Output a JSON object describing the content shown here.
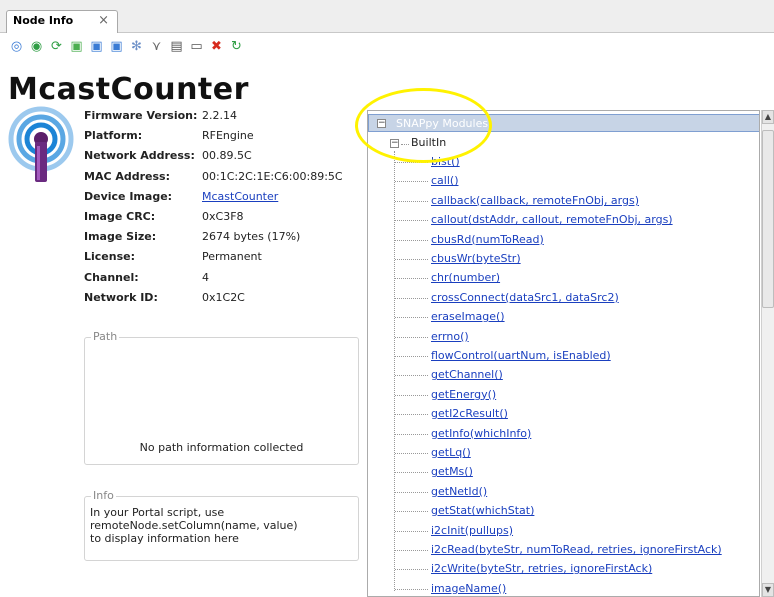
{
  "tab": {
    "label": "Node Info",
    "close_glyph": "×"
  },
  "toolbar": {
    "buttons": [
      {
        "icon": "ping-icon",
        "glyph": "◎",
        "color": "#3a7bd5"
      },
      {
        "icon": "refresh-icon",
        "glyph": "◉",
        "color": "#2f9e44"
      },
      {
        "icon": "sync-icon",
        "glyph": "⟳",
        "color": "#2f9e44"
      },
      {
        "icon": "upload-script-icon",
        "glyph": "▣",
        "color": "#4caf50"
      },
      {
        "icon": "script-icon",
        "glyph": "▣",
        "color": "#3a7bd5"
      },
      {
        "icon": "script-edit-icon",
        "glyph": "▣",
        "color": "#3a7bd5"
      },
      {
        "icon": "gear-icon",
        "glyph": "✻",
        "color": "#6b8fc7"
      },
      {
        "icon": "network-icon",
        "glyph": "⋎",
        "color": "#666666"
      },
      {
        "icon": "copy-icon",
        "glyph": "▤",
        "color": "#555555"
      },
      {
        "icon": "minimize-icon",
        "glyph": "▭",
        "color": "#555555"
      },
      {
        "icon": "delete-icon",
        "glyph": "✖",
        "color": "#d62b1e"
      },
      {
        "icon": "reload-icon",
        "glyph": "↻",
        "color": "#2f9e44"
      }
    ]
  },
  "node": {
    "name": "McastCounter",
    "fields": [
      {
        "label": "Firmware Version:",
        "value": "2.2.14",
        "link": false
      },
      {
        "label": "Platform:",
        "value": "RFEngine",
        "link": false
      },
      {
        "label": "Network Address:",
        "value": "00.89.5C",
        "link": false
      },
      {
        "label": "MAC Address:",
        "value": "00:1C:2C:1E:C6:00:89:5C",
        "link": false
      },
      {
        "label": "Device Image:",
        "value": "McastCounter",
        "link": true
      },
      {
        "label": "Image CRC:",
        "value": "0xC3F8",
        "link": false
      },
      {
        "label": "Image Size:",
        "value": "2674 bytes (17%)",
        "link": false
      },
      {
        "label": "License:",
        "value": "Permanent",
        "link": false
      },
      {
        "label": "Channel:",
        "value": "4",
        "link": false
      },
      {
        "label": "Network ID:",
        "value": "0x1C2C",
        "link": false
      }
    ]
  },
  "path_group": {
    "title": "Path",
    "message": "No path information collected"
  },
  "info_group": {
    "title": "Info",
    "lines": [
      "In your Portal script, use",
      "remoteNode.setColumn(name, value)",
      "to display information here"
    ]
  },
  "tree": {
    "root": "SNAPpy Modules",
    "builtin": "BuiltIn",
    "functions": [
      "bist()",
      "call()",
      "callback(callback, remoteFnObj, args)",
      "callout(dstAddr, callout, remoteFnObj, args)",
      "cbusRd(numToRead)",
      "cbusWr(byteStr)",
      "chr(number)",
      "crossConnect(dataSrc1, dataSrc2)",
      "eraseImage()",
      "errno()",
      "flowControl(uartNum, isEnabled)",
      "getChannel()",
      "getEnergy()",
      "getI2cResult()",
      "getInfo(whichInfo)",
      "getLq()",
      "getMs()",
      "getNetId()",
      "getStat(whichStat)",
      "i2cInit(pullups)",
      "i2cRead(byteStr, numToRead, retries, ignoreFirstAck)",
      "i2cWrite(byteStr, retries, ignoreFirstAck)",
      "imageName()"
    ]
  },
  "colors": {
    "link": "#1a3fbf",
    "highlight": "#fff200",
    "selection": "#c7d4e6"
  }
}
